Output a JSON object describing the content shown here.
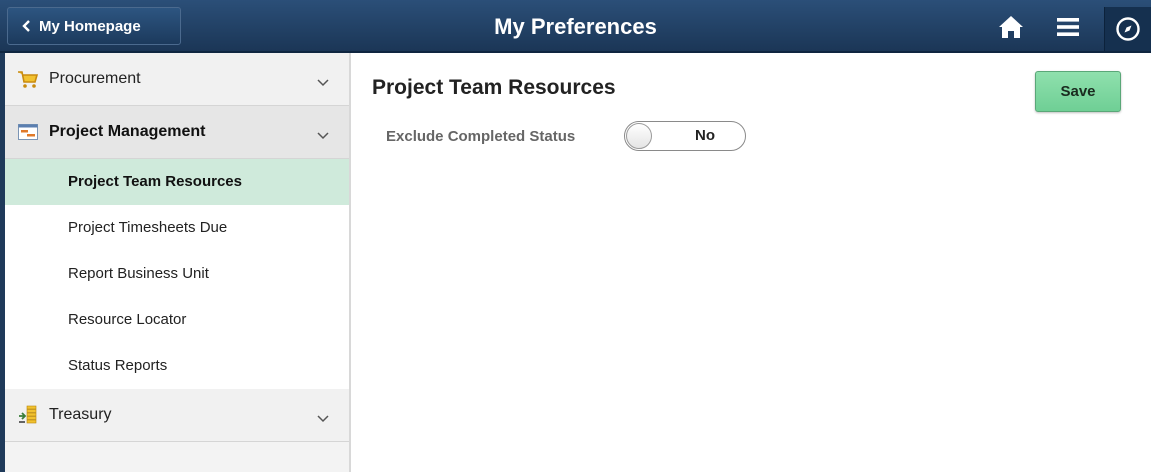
{
  "header": {
    "back_label": "My Homepage",
    "title": "My Preferences",
    "icons": [
      "home-icon",
      "menu-icon",
      "navbar-compass-icon"
    ],
    "background": "#1f3a5a"
  },
  "sidebar": {
    "groups": [
      {
        "label": "Procurement",
        "icon": "shopping-cart-icon",
        "expanded": false
      },
      {
        "label": "Project Management",
        "icon": "project-gantt-icon",
        "expanded": true
      },
      {
        "label": "Treasury",
        "icon": "treasury-coins-icon",
        "expanded": false
      }
    ],
    "project_items": [
      {
        "label": "Project Team Resources",
        "selected": true
      },
      {
        "label": "Project Timesheets Due",
        "selected": false
      },
      {
        "label": "Report Business Unit",
        "selected": false
      },
      {
        "label": "Resource Locator",
        "selected": false
      },
      {
        "label": "Status Reports",
        "selected": false
      }
    ],
    "selected_color": "#cfeadb"
  },
  "main": {
    "title": "Project Team Resources",
    "save_label": "Save",
    "save_color": "#7fd8a0",
    "field_label": "Exclude Completed Status",
    "toggle_value": "No"
  }
}
